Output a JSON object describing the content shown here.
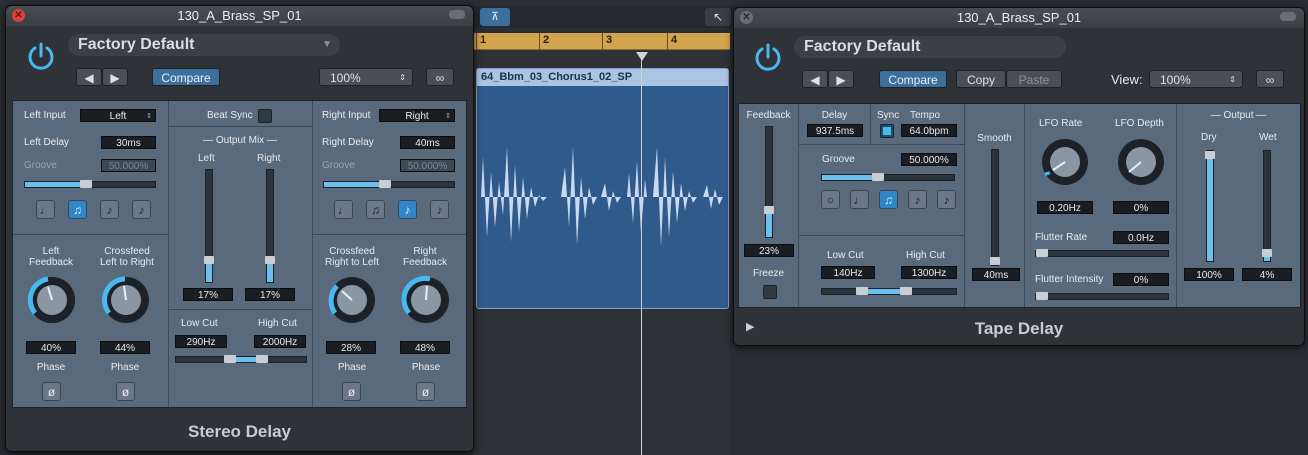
{
  "daw": {
    "ruler_ticks": [
      "1",
      "2",
      "3",
      "4"
    ],
    "region_name": "64_Bbm_03_Chorus1_02_SP"
  },
  "stereo_delay": {
    "window_title": "130_A_Brass_SP_01",
    "preset": "Factory Default",
    "compare_label": "Compare",
    "zoom": "100%",
    "plugin_name": "Stereo Delay",
    "left_input_label": "Left Input",
    "left_input_value": "Left",
    "left_delay_label": "Left Delay",
    "left_delay_value": "30ms",
    "left_groove_label": "Groove",
    "left_groove_value": "50.000%",
    "beat_sync_label": "Beat Sync",
    "output_mix_label": "Output Mix",
    "mix_left_label": "Left",
    "mix_right_label": "Right",
    "mix_left_value": "17%",
    "mix_right_value": "17%",
    "mix_left_level": 0.17,
    "mix_right_level": 0.17,
    "right_input_label": "Right Input",
    "right_input_value": "Right",
    "right_delay_label": "Right Delay",
    "right_delay_value": "40ms",
    "right_groove_label": "Groove",
    "right_groove_value": "50.000%",
    "left_feedback_label_1": "Left",
    "left_feedback_label_2": "Feedback",
    "left_feedback_value": "40%",
    "crossfeed_lr_label_1": "Crossfeed",
    "crossfeed_lr_label_2": "Left to Right",
    "crossfeed_lr_value": "44%",
    "crossfeed_rl_label_1": "Crossfeed",
    "crossfeed_rl_label_2": "Right to Left",
    "crossfeed_rl_value": "28%",
    "right_feedback_label_1": "Right",
    "right_feedback_label_2": "Feedback",
    "right_feedback_value": "48%",
    "phase_label": "Phase",
    "phase_symbol": "ø",
    "low_cut_label": "Low Cut",
    "low_cut_value": "290Hz",
    "high_cut_label": "High Cut",
    "high_cut_value": "2000Hz"
  },
  "tape_delay": {
    "window_title": "130_A_Brass_SP_01",
    "preset": "Factory Default",
    "compare_label": "Compare",
    "copy_label": "Copy",
    "paste_label": "Paste",
    "view_label": "View:",
    "zoom": "100%",
    "plugin_name": "Tape Delay",
    "feedback_label": "Feedback",
    "feedback_value": "23%",
    "feedback_level": 0.23,
    "freeze_label": "Freeze",
    "delay_label": "Delay",
    "delay_value": "937.5ms",
    "sync_label": "Sync",
    "tempo_label": "Tempo",
    "tempo_value": "64.0bpm",
    "groove_label": "Groove",
    "groove_value": "50.000%",
    "low_cut_label": "Low Cut",
    "low_cut_value": "140Hz",
    "high_cut_label": "High Cut",
    "high_cut_value": "1300Hz",
    "smooth_label": "Smooth",
    "smooth_value": "40ms",
    "lfo_rate_label": "LFO Rate",
    "lfo_rate_value": "0.20Hz",
    "lfo_depth_label": "LFO Depth",
    "lfo_depth_value": "0%",
    "flutter_rate_label": "Flutter Rate",
    "flutter_rate_value": "0.0Hz",
    "flutter_intensity_label": "Flutter Intensity",
    "flutter_intensity_value": "0%",
    "output_label": "Output",
    "dry_label": "Dry",
    "wet_label": "Wet",
    "dry_value": "100%",
    "wet_value": "4%",
    "dry_level": 1.0,
    "wet_level": 0.04
  },
  "colors": {
    "accent": "#4ab8f0",
    "panel": "#5a6a7d",
    "value_bg": "#1a1e22",
    "close_red": "#d8433a"
  }
}
